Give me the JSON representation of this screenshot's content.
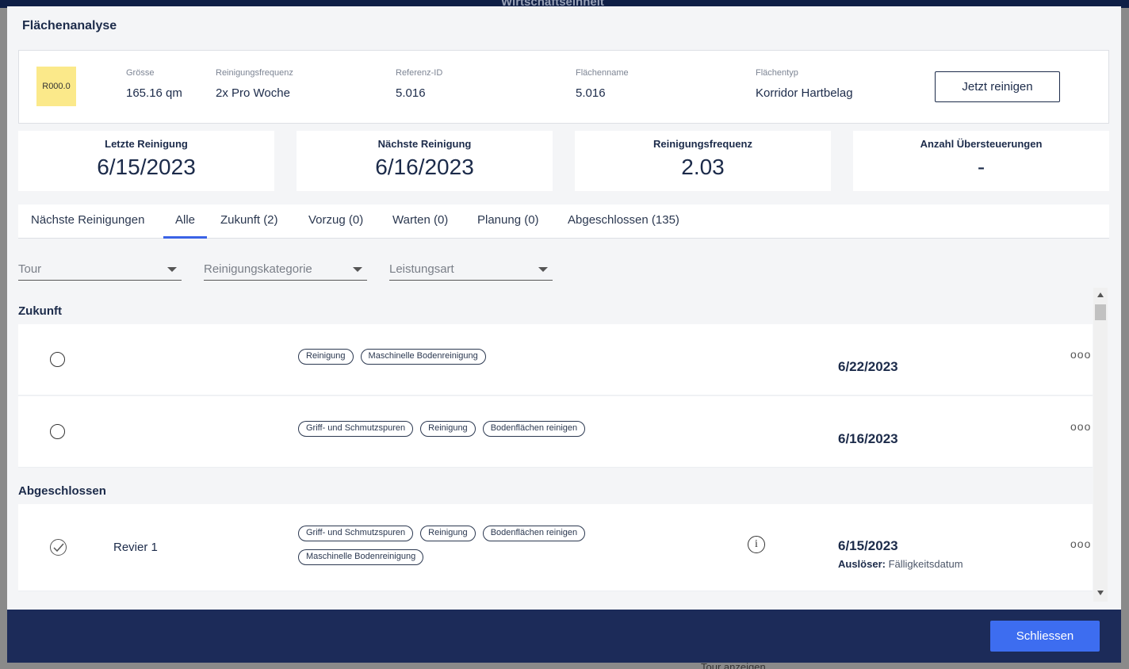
{
  "background": {
    "window_title": "Wirtschaftseinheit",
    "bottom_text": "Tour anzeigen"
  },
  "modal": {
    "title": "Flächenanalyse",
    "area_code": "R000.0",
    "fields": [
      {
        "label": "Grösse",
        "value": "165.16 qm"
      },
      {
        "label": "Reinigungsfrequenz",
        "value": "2x Pro Woche"
      },
      {
        "label": "Referenz-ID",
        "value": "5.016"
      },
      {
        "label": "Flächenname",
        "value": "5.016"
      },
      {
        "label": "Flächentyp",
        "value": "Korridor Hartbelag"
      }
    ],
    "clean_now_label": "Jetzt reinigen",
    "badge_color": "#fbe98a"
  },
  "stats": [
    {
      "label": "Letzte Reinigung",
      "value": "6/15/2023"
    },
    {
      "label": "Nächste Reinigung",
      "value": "6/16/2023"
    },
    {
      "label": "Reinigungsfrequenz",
      "value": "2.03"
    },
    {
      "label": "Anzahl Übersteuerungen",
      "value": "-"
    }
  ],
  "tabs": [
    {
      "label": "Nächste Reinigungen",
      "active": false
    },
    {
      "label": "Alle",
      "active": true
    },
    {
      "label": "Zukunft (2)",
      "active": false
    },
    {
      "label": "Vorzug (0)",
      "active": false
    },
    {
      "label": "Warten (0)",
      "active": false
    },
    {
      "label": "Planung (0)",
      "active": false
    },
    {
      "label": "Abgeschlossen (135)",
      "active": false
    }
  ],
  "filters": [
    {
      "label": "Tour"
    },
    {
      "label": "Reinigungskategorie"
    },
    {
      "label": "Leistungsart"
    }
  ],
  "sections": {
    "future": {
      "title": "Zukunft",
      "rows": [
        {
          "tags": [
            "Reinigung",
            "Maschinelle Bodenreinigung"
          ],
          "date": "6/22/2023",
          "menu": "ooo"
        },
        {
          "tags": [
            "Griff- und Schmutzspuren",
            "Reinigung",
            "Bodenflächen reinigen"
          ],
          "date": "6/16/2023",
          "menu": "ooo"
        }
      ]
    },
    "completed": {
      "title": "Abgeschlossen",
      "rows": [
        {
          "tour": "Revier 1",
          "tags": [
            "Griff- und Schmutzspuren",
            "Reinigung",
            "Bodenflächen reinigen",
            "Maschinelle Bodenreinigung"
          ],
          "date": "6/15/2023",
          "trigger_label": "Auslöser:",
          "trigger_value": "Fälligkeitsdatum",
          "info_icon": "i",
          "menu": "ooo"
        }
      ]
    }
  },
  "footer": {
    "close_label": "Schliessen",
    "accent": "#3d6df0",
    "bar_color": "#1c2b59"
  }
}
